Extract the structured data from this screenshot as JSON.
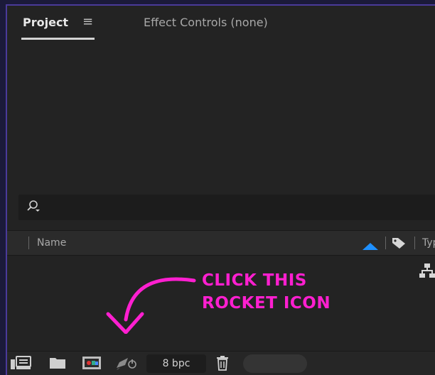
{
  "tabs": {
    "project_label": "Project",
    "menu_glyph": "≡",
    "effect_controls_label": "Effect Controls (none)"
  },
  "search": {
    "placeholder": "",
    "icon": "search-icon"
  },
  "columns": {
    "name": "Name",
    "type": "Typ"
  },
  "annotation": {
    "line1": "CLICK THIS",
    "line2": "ROCKET ICON",
    "color": "#ff1fd0"
  },
  "bottombar": {
    "bit_depth": "8 bpc",
    "icons": [
      "interpret-footage-icon",
      "new-folder-icon",
      "new-composition-icon",
      "rocket-renderer-icon",
      "trash-icon"
    ]
  },
  "colors": {
    "panel": "#232323",
    "accent_blue": "#1e90ff",
    "outer_border": "#4a3a9a"
  }
}
